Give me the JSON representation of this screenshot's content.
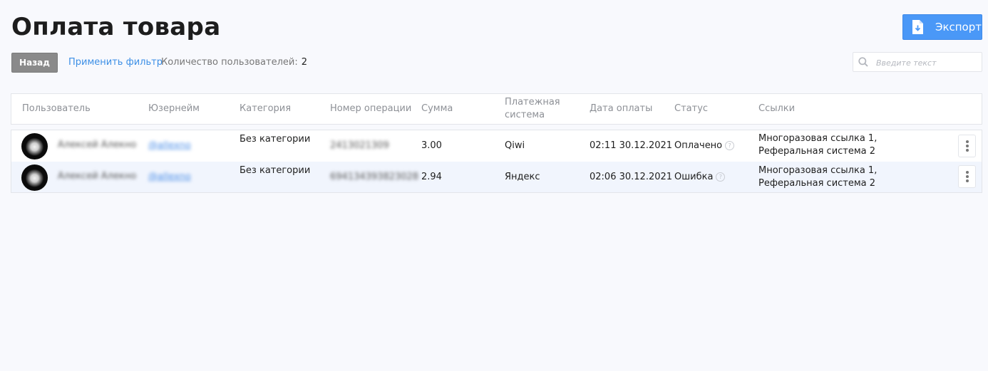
{
  "page": {
    "title": "Оплата товара",
    "export_label": "Экспорт"
  },
  "toolbar": {
    "back_label": "Назад",
    "filter_label": "Применить фильтр",
    "user_count_label": "Количество пользователей:",
    "user_count_value": "2",
    "search_placeholder": "Введите текст"
  },
  "table": {
    "columns": [
      "Пользователь",
      "Юзернейм",
      "Категория",
      "Номер операции",
      "Сумма",
      "Платежная система",
      "Дата оплаты",
      "Статус",
      "Ссылки"
    ],
    "rows": [
      {
        "name": "Алексей Алекно",
        "username": "@allexno",
        "category": "Без категории",
        "operation": "2413021309",
        "amount": "3.00",
        "system": "Qiwi",
        "date": "02:11 30.12.2021",
        "status": "Оплачено",
        "links_line1": "Многоразовая ссылка 1,",
        "links_line2": "Реферальная система 2"
      },
      {
        "name": "Алексей Алекно",
        "username": "@allexno",
        "category": "Без категории",
        "operation": "694134393823028",
        "amount": "2.94",
        "system": "Яндекс",
        "date": "02:06 30.12.2021",
        "status": "Ошибка",
        "links_line1": "Многоразовая ссылка 1,",
        "links_line2": "Реферальная система 2"
      }
    ]
  },
  "icons": {
    "export": "file-download-icon",
    "search": "search-icon",
    "help": "question-circle-icon",
    "more": "more-vertical-icon"
  },
  "colors": {
    "accent": "#4a98f7",
    "link": "#3c8fe6",
    "back_button": "#8a8a8a",
    "alt_row": "#f1f5fd"
  }
}
